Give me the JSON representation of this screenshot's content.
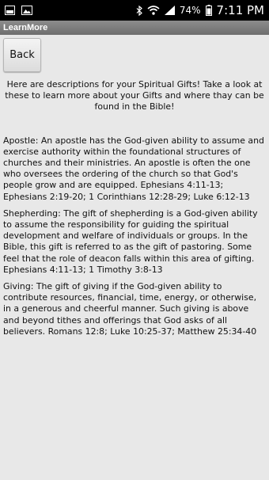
{
  "status_bar": {
    "icons_left": [
      "gallery-icon",
      "photo-icon"
    ],
    "icons_right": [
      "bluetooth-icon",
      "wifi-icon",
      "signal-icon",
      "battery-icon"
    ],
    "battery": "74%",
    "time": "7:11 PM"
  },
  "app": {
    "title": "LearnMore"
  },
  "back_button": {
    "label": "Back"
  },
  "intro": "Here are descriptions for your Spiritual Gifts! Take a look at these to learn more about your Gifts and where thay can be found in the Bible!",
  "gifts": [
    {
      "text": "Apostle: An apostle has the God-given ability to assume and exercise authority within the foundational structures of churches and their ministries. An apostle is often the one who oversees the ordering of the church so that God's people grow and are equipped. Ephesians 4:11-13; Ephesians 2:19-20; 1 Corinthians 12:28-29; Luke 6:12-13"
    },
    {
      "text": "Shepherding: The gift of shepherding is a God-given ability to assume the responsibility for guiding the spiritual development and welfare of individuals or groups. In the Bible, this gift is referred to as the gift of pastoring. Some feel that the role of deacon falls within this area of gifting. Ephesians 4:11-13; 1 Timothy 3:8-13"
    },
    {
      "text": "Giving: The gift of giving if the God-given ability to contribute resources, financial, time, energy, or otherwise, in a generous and cheerful manner. Such giving is above and beyond tithes and offerings that God asks of all believers. Romans 12:8; Luke 10:25-37; Matthew 25:34-40"
    }
  ]
}
